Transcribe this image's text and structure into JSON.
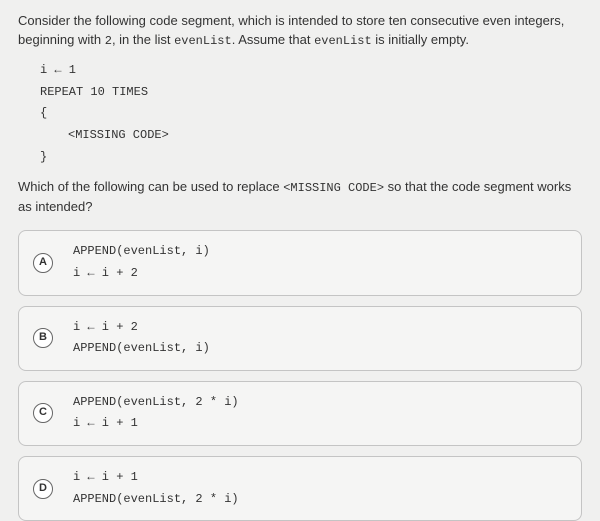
{
  "question": {
    "intro_part1": "Consider the following code segment, which is intended to store ten consecutive even integers, beginning with ",
    "intro_code1": "2",
    "intro_part2": ", in the list ",
    "intro_code2": "evenList",
    "intro_part3": ". Assume that ",
    "intro_code3": "evenList",
    "intro_part4": " is initially empty.",
    "code": {
      "line1": "i ← 1",
      "line2": "REPEAT 10 TIMES",
      "line3": "{",
      "line4": "<MISSING CODE>",
      "line5": "}"
    },
    "followup_part1": "Which of the following can be used to replace ",
    "followup_code": "<MISSING CODE>",
    "followup_part2": " so that the code segment works as intended?"
  },
  "options": [
    {
      "letter": "A",
      "code": "APPEND(evenList, i)\ni ← i + 2"
    },
    {
      "letter": "B",
      "code": "i ← i + 2\nAPPEND(evenList, i)"
    },
    {
      "letter": "C",
      "code": "APPEND(evenList, 2 * i)\ni ← i + 1"
    },
    {
      "letter": "D",
      "code": "i ← i + 1\nAPPEND(evenList, 2 * i)"
    }
  ]
}
